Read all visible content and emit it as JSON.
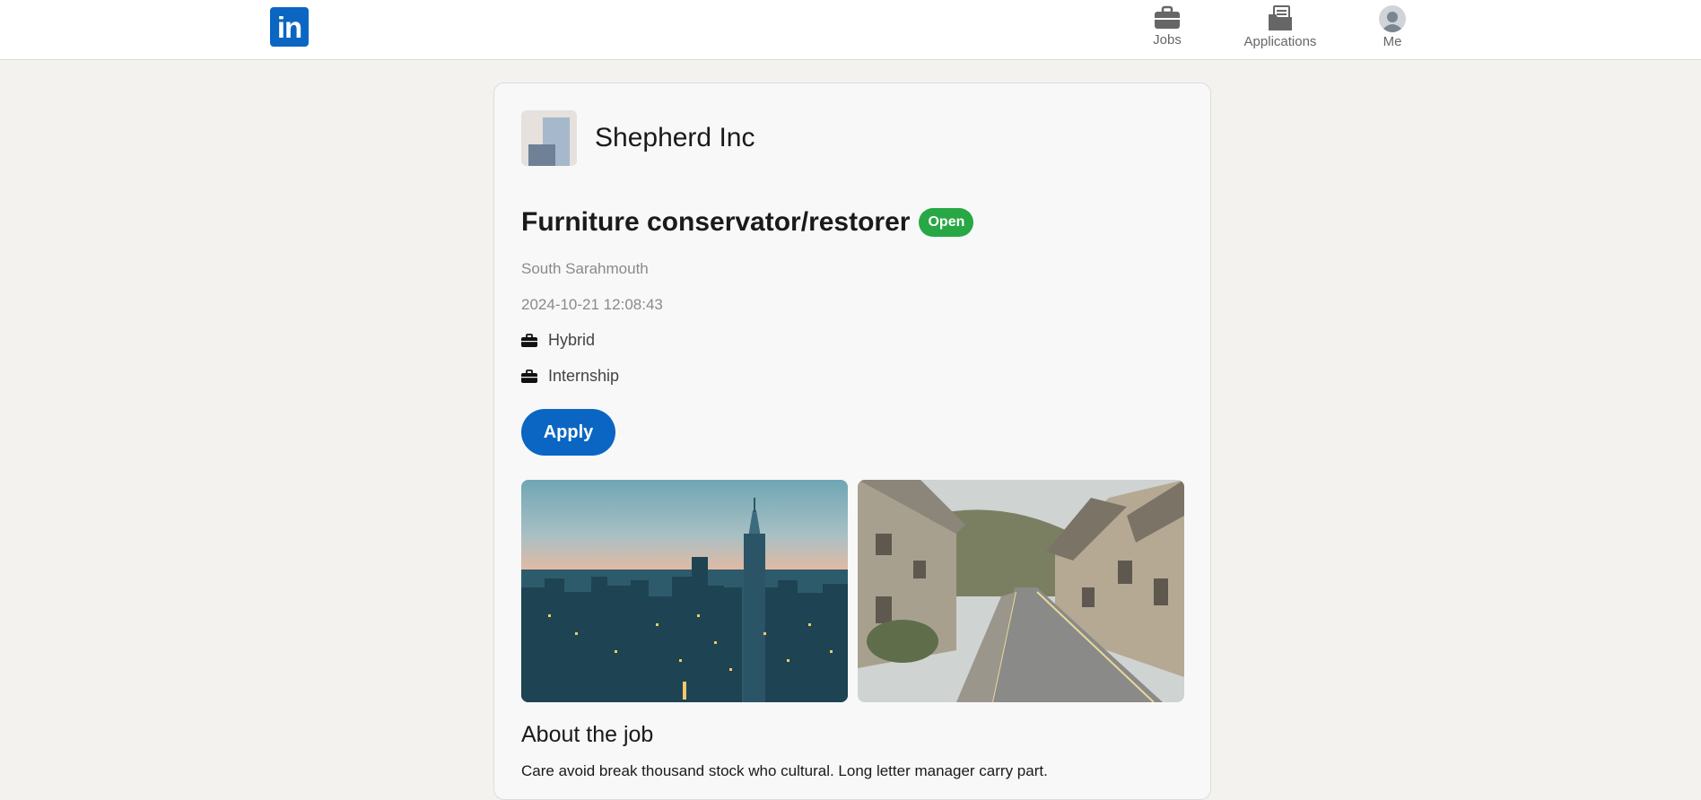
{
  "header": {
    "logo_text": "in",
    "nav": [
      {
        "label": "Jobs",
        "icon": "briefcase-icon"
      },
      {
        "label": "Applications",
        "icon": "applications-folder-icon"
      },
      {
        "label": "Me",
        "icon": "avatar"
      }
    ]
  },
  "company": {
    "name": "Shepherd Inc",
    "logo_icon": "company-logo"
  },
  "job": {
    "title": "Furniture conservator/restorer",
    "status": "Open",
    "location": "South Sarahmouth",
    "posted": "2024-10-21 12:08:43",
    "workplace_type": "Hybrid",
    "employment_type": "Internship",
    "apply_label": "Apply"
  },
  "images": [
    {
      "subject": "city-skyline-photo"
    },
    {
      "subject": "village-street-photo"
    }
  ],
  "about": {
    "heading": "About the job",
    "text": "Care avoid break thousand stock who cultural. Long letter manager carry part."
  },
  "colors": {
    "brand": "#0a66c2",
    "status_open": "#28a745",
    "page_bg": "#f3f2ef",
    "card_bg": "#f8f8f8"
  }
}
